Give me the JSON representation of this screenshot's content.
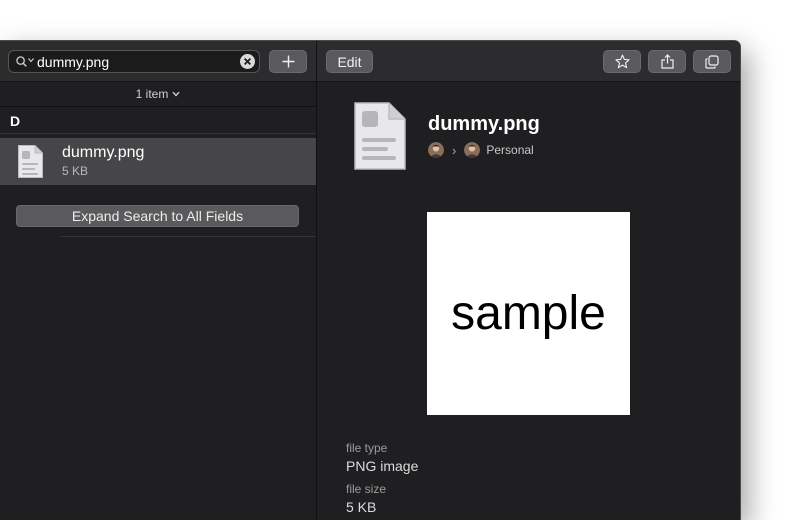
{
  "search": {
    "value": "dummy.png"
  },
  "toolbar": {
    "edit_label": "Edit"
  },
  "list": {
    "count_label": "1 item",
    "section_header": "D",
    "items": [
      {
        "name": "dummy.png",
        "size": "5 KB"
      }
    ],
    "expand_button_label": "Expand Search to All Fields"
  },
  "detail": {
    "title": "dummy.png",
    "breadcrumb_vault": "Personal",
    "preview_text": "sample",
    "fields": [
      {
        "label": "file type",
        "value": "PNG image"
      },
      {
        "label": "file size",
        "value": "5 KB"
      }
    ]
  },
  "icons": {
    "search": "magnifier-icon",
    "clear": "clear-icon",
    "add": "plus-icon",
    "favorite": "star-icon",
    "share": "share-icon",
    "duplicate": "duplicate-icon",
    "document": "document-icon"
  },
  "colors": {
    "window_bg": "#1f1f21",
    "toolbar_bg": "#2c2c2e",
    "selected_row": "#464648",
    "button_bg": "#5a5a5c"
  }
}
